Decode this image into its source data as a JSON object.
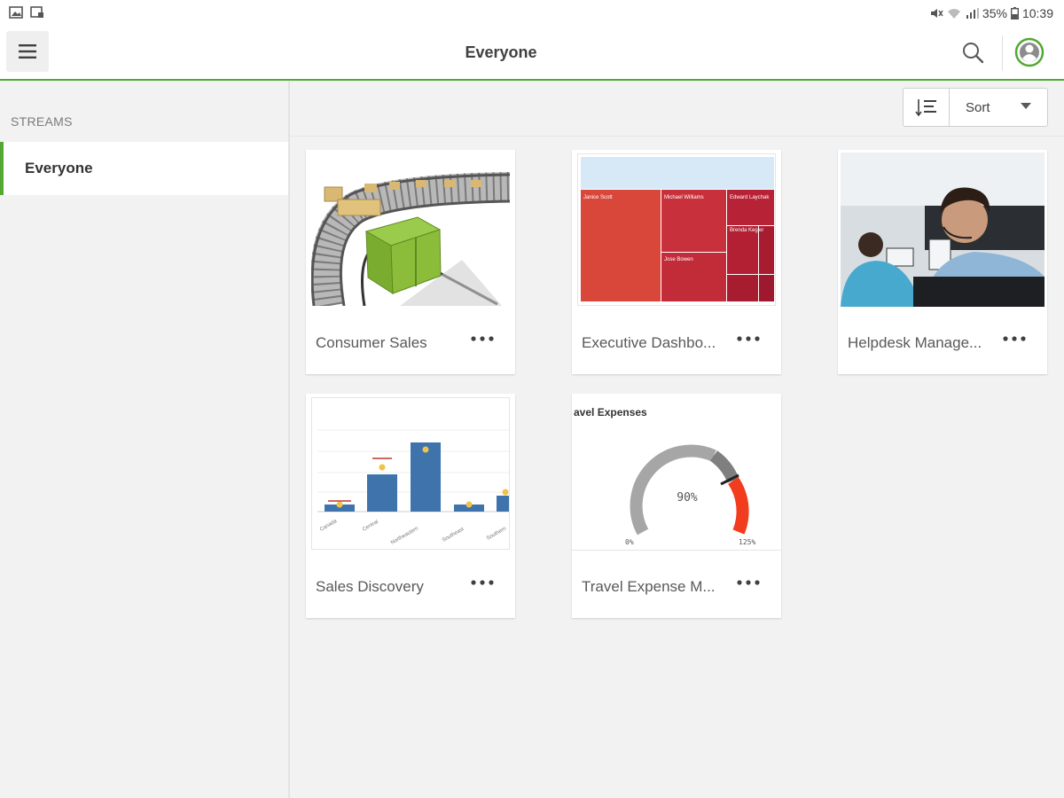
{
  "status_bar": {
    "battery": "35%",
    "time": "10:39",
    "icons": [
      "image-notification-icon",
      "cast-notification-icon",
      "mute-icon",
      "wifi-icon",
      "signal-icon",
      "battery-icon"
    ]
  },
  "header": {
    "title": "Everyone",
    "icons": [
      "hamburger-menu-icon",
      "search-icon",
      "user-profile-icon"
    ],
    "accent_color": "#52a832"
  },
  "sidebar": {
    "heading": "STREAMS",
    "items": [
      {
        "label": "Everyone",
        "selected": true
      }
    ]
  },
  "toolbar": {
    "sort_label": "Sort",
    "icons": [
      "sort-order-icon",
      "chevron-down-icon"
    ]
  },
  "apps": [
    {
      "title": "Consumer Sales",
      "thumbnail": "conveyor-belt-boxes"
    },
    {
      "title": "Executive Dashbo...",
      "thumbnail": "treemap",
      "thumb_labels": [
        "Janice Scott",
        "Michael Williams",
        "Edward Laychak",
        "Brenda Kegler",
        "Jose Bowen"
      ]
    },
    {
      "title": "Helpdesk Manage...",
      "thumbnail": "helpdesk-agent-photo"
    },
    {
      "title": "Sales Discovery",
      "thumbnail": "bar-chart",
      "thumb_labels": [
        "Canada",
        "Central",
        "Northeastern",
        "Southeast",
        "Southern"
      ]
    },
    {
      "title": "Travel Expense M...",
      "thumbnail": "gauge",
      "thumb_labels": [
        "avel Expenses",
        "90%",
        "0%",
        "125%"
      ]
    }
  ]
}
